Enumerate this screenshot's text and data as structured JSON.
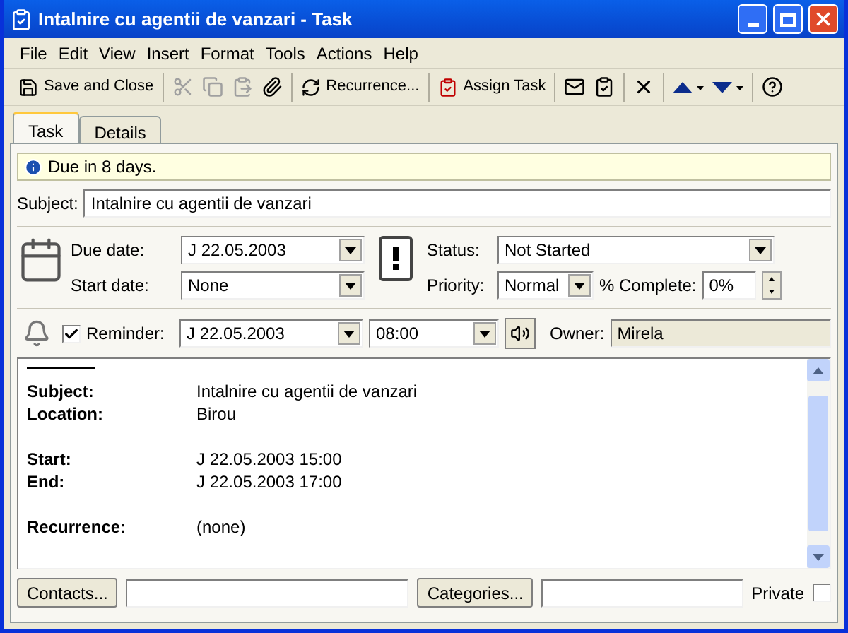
{
  "window": {
    "title": "Intalnire cu agentii de vanzari - Task"
  },
  "menu": [
    "File",
    "Edit",
    "View",
    "Insert",
    "Format",
    "Tools",
    "Actions",
    "Help"
  ],
  "toolbar": [
    {
      "kind": "button",
      "label": "Save and Close",
      "disabled": false
    },
    {
      "kind": "icon",
      "disabled": true
    },
    {
      "kind": "icon",
      "disabled": true
    },
    {
      "kind": "icon",
      "disabled": true
    },
    {
      "kind": "icon",
      "disabled": false
    },
    {
      "kind": "button",
      "label": "Recurrence...",
      "disabled": false
    },
    {
      "kind": "button",
      "label": "Assign Task",
      "disabled": false
    },
    {
      "kind": "icon",
      "disabled": false
    },
    {
      "kind": "icon",
      "disabled": false
    },
    {
      "kind": "icon",
      "disabled": false
    },
    {
      "kind": "icon",
      "disabled": false
    },
    {
      "kind": "icon",
      "disabled": false
    },
    {
      "kind": "icon",
      "disabled": false
    }
  ],
  "tabs": [
    {
      "label": "Task",
      "selected": true
    },
    {
      "label": "Details",
      "selected": false
    }
  ],
  "info": "Due in 8 days.",
  "subject": {
    "label": "Subject:",
    "value": "Intalnire cu agentii de vanzari"
  },
  "due_date": {
    "label": "Due date:",
    "value": "J 22.05.2003"
  },
  "start_date": {
    "label": "Start date:",
    "value": "None"
  },
  "status": {
    "label": "Status:",
    "value": "Not Started"
  },
  "priority": {
    "label": "Priority:",
    "value": "Normal"
  },
  "complete": {
    "label": "% Complete:",
    "value": "0%"
  },
  "reminder": {
    "label": "Reminder:",
    "checked": true,
    "date": "J 22.05.2003",
    "time": "08:00"
  },
  "owner": {
    "label": "Owner:",
    "value": "Mirela"
  },
  "notes": [
    {
      "kind": "row",
      "label": "Subject:",
      "value": "Intalnire cu agentii de vanzari"
    },
    {
      "kind": "row",
      "label": "Location:",
      "value": "Birou"
    },
    {
      "kind": "gap"
    },
    {
      "kind": "row",
      "label": "Start:",
      "value": "J 22.05.2003 15:00"
    },
    {
      "kind": "row",
      "label": "End:",
      "value": "J 22.05.2003 17:00"
    },
    {
      "kind": "gap"
    },
    {
      "kind": "row",
      "label": "Recurrence:",
      "value": "(none)"
    }
  ],
  "footer": {
    "contacts": "Contacts...",
    "categories": "Categories...",
    "private": {
      "label": "Private",
      "checked": false
    }
  }
}
